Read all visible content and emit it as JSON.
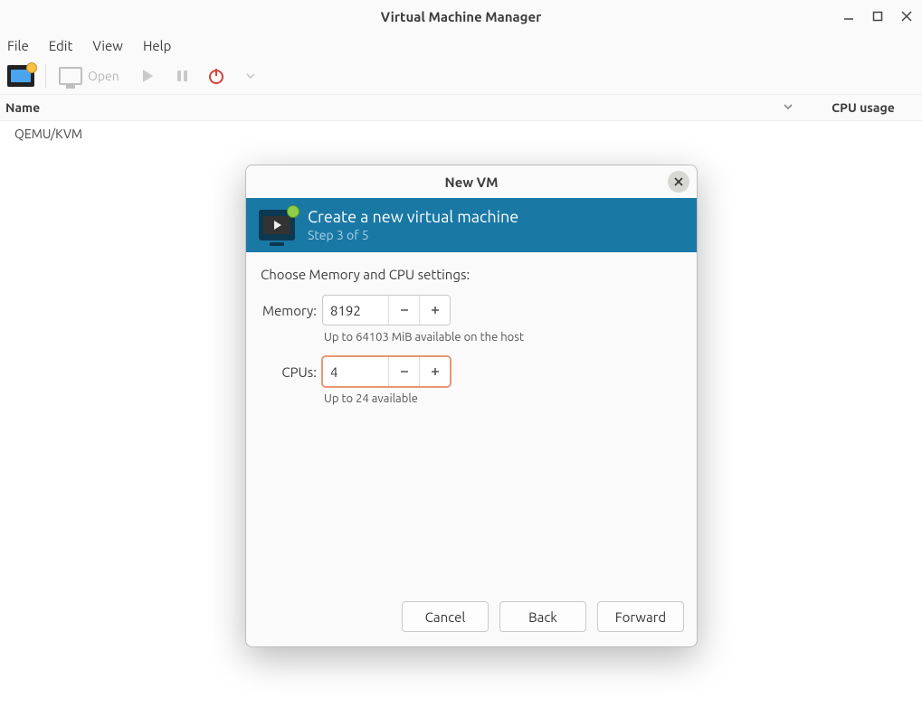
{
  "window": {
    "title": "Virtual Machine Manager"
  },
  "menubar": {
    "items": [
      "File",
      "Edit",
      "View",
      "Help"
    ]
  },
  "toolbar": {
    "open_label": "Open"
  },
  "columns": {
    "name": "Name",
    "cpu": "CPU usage"
  },
  "vm_list": {
    "items": [
      {
        "name": "QEMU/KVM"
      }
    ]
  },
  "dialog": {
    "title": "New VM",
    "banner": {
      "heading": "Create a new virtual machine",
      "step": "Step 3 of 5"
    },
    "section_label": "Choose Memory and CPU settings:",
    "memory": {
      "label": "Memory:",
      "value": "8192",
      "hint": "Up to 64103 MiB available on the host"
    },
    "cpus": {
      "label": "CPUs:",
      "value": "4",
      "hint": "Up to 24 available"
    },
    "buttons": {
      "cancel": "Cancel",
      "back": "Back",
      "forward": "Forward"
    }
  }
}
